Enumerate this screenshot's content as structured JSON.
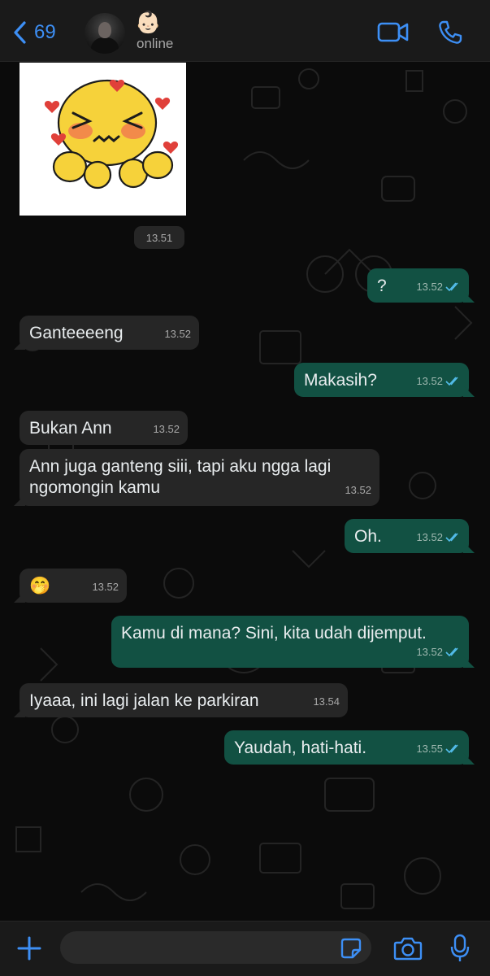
{
  "header": {
    "back_count": "69",
    "contact_name": "👶🏻",
    "status": "online",
    "accent": "#3d8ff5"
  },
  "sticker": {
    "description_icon": "blushing-emoji-sticker"
  },
  "day_time": "13.51",
  "messages": [
    {
      "dir": "out",
      "text": "?",
      "time": "13.52",
      "read": true
    },
    {
      "dir": "in",
      "text": "Ganteeeeng",
      "time": "13.52"
    },
    {
      "dir": "out",
      "text": "Makasih?",
      "time": "13.52",
      "read": true
    },
    {
      "dir": "in",
      "text": "Bukan Ann",
      "time": "13.52"
    },
    {
      "dir": "in",
      "text": "Ann juga ganteng siii, tapi aku ngga lagi ngomongin kamu",
      "time": "13.52"
    },
    {
      "dir": "out",
      "text": "Oh.",
      "time": "13.52",
      "read": true
    },
    {
      "dir": "in",
      "text": "🤭",
      "time": "13.52"
    },
    {
      "dir": "out",
      "text": "Kamu di mana? Sini, kita udah dijemput.",
      "time": "13.52",
      "read": true
    },
    {
      "dir": "in",
      "text": "Iyaaa, ini lagi jalan ke parkiran",
      "time": "13.54"
    },
    {
      "dir": "out",
      "text": "Yaudah, hati-hati.",
      "time": "13.55",
      "read": true
    }
  ],
  "composer": {
    "placeholder": ""
  },
  "colors": {
    "incoming_bubble": "#262626",
    "outgoing_bubble": "#125143",
    "read_ticks": "#53bdeb"
  }
}
